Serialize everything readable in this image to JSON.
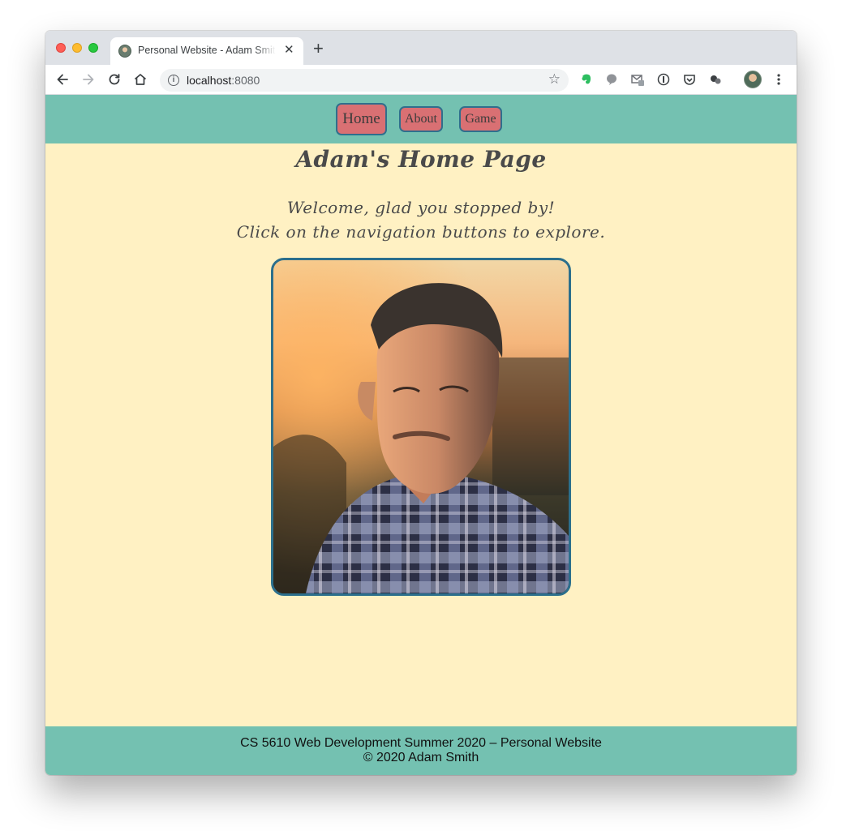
{
  "browser": {
    "tab_title": "Personal Website - Adam Smith",
    "tab_close": "✕",
    "new_tab": "+",
    "url_host": "localhost",
    "url_port": ":8080",
    "star": "☆"
  },
  "nav": {
    "home": "Home",
    "about": "About",
    "game": "Game"
  },
  "page": {
    "title": "Adam's Home Page",
    "welcome_line1": "Welcome, glad you stopped by!",
    "welcome_line2": "Click on the navigation buttons to explore."
  },
  "footer": {
    "line1": "CS 5610 Web Development Summer 2020 – Personal Website",
    "line2": "© 2020 Adam Smith"
  },
  "colors": {
    "nav_bg": "#74c1b1",
    "page_bg": "#fff1c3",
    "button_bg": "#d97073",
    "button_border": "#2f6f8d"
  }
}
